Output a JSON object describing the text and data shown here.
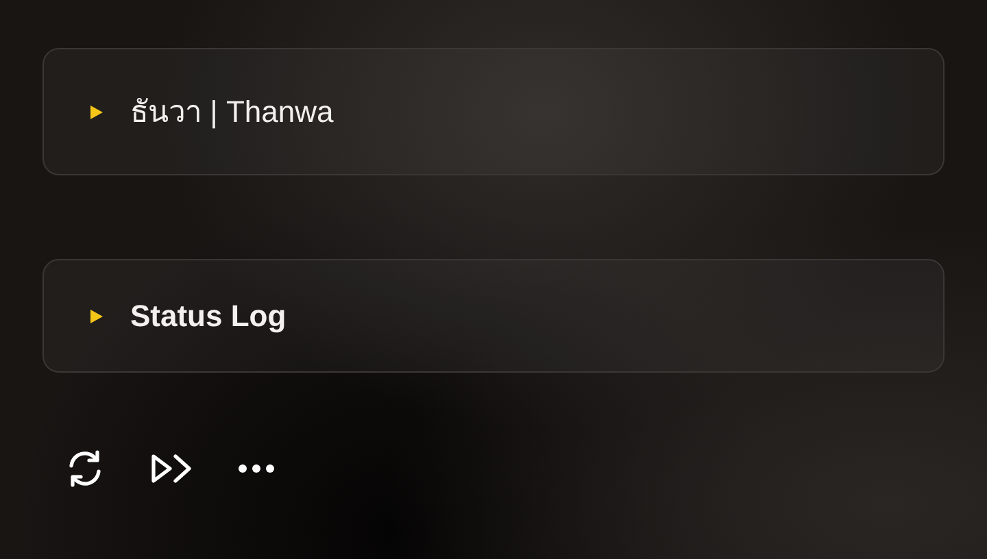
{
  "panels": [
    {
      "title": "ธันวา | Thanwa",
      "expanded": false,
      "bold": false
    },
    {
      "title": "Status Log",
      "expanded": false,
      "bold": true
    }
  ],
  "toolbar": [
    {
      "kind": "refresh"
    },
    {
      "kind": "skip"
    },
    {
      "kind": "more"
    }
  ]
}
